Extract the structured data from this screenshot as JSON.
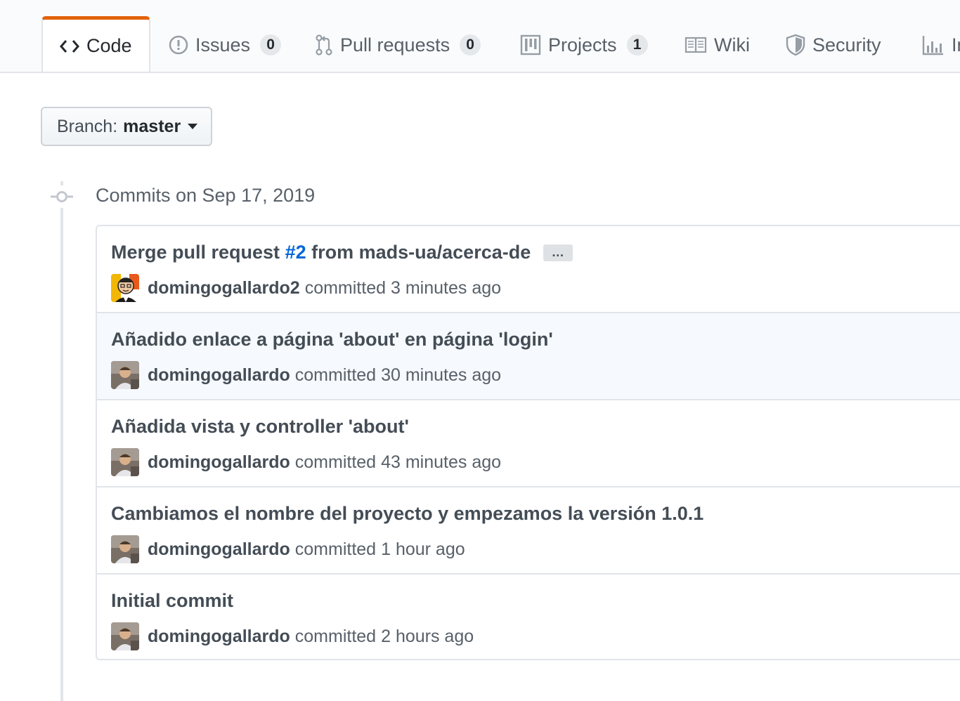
{
  "tabs": [
    {
      "label": "Code",
      "icon": "code-icon",
      "counter": null,
      "selected": true
    },
    {
      "label": "Issues",
      "icon": "issue-opened-icon",
      "counter": "0",
      "selected": false
    },
    {
      "label": "Pull requests",
      "icon": "git-pull-request-icon",
      "counter": "0",
      "selected": false
    },
    {
      "label": "Projects",
      "icon": "project-icon",
      "counter": "1",
      "selected": false
    },
    {
      "label": "Wiki",
      "icon": "book-icon",
      "counter": null,
      "selected": false
    },
    {
      "label": "Security",
      "icon": "shield-icon",
      "counter": null,
      "selected": false
    },
    {
      "label": "In",
      "icon": "graph-icon",
      "counter": null,
      "selected": false
    }
  ],
  "branch": {
    "prefix": "Branch:",
    "name": "master"
  },
  "day_heading": "Commits on Sep 17, 2019",
  "commits": [
    {
      "title_prefix": "Merge pull request ",
      "title_link": "#2",
      "title_suffix": " from mads-ua/acerca-de",
      "has_ellipsis": true,
      "ellipsis": "…",
      "author": "domingogallardo2",
      "verb": "committed",
      "time": "3 minutes ago",
      "avatar": "cartoon-avatar",
      "highlight": false
    },
    {
      "title_prefix": "Añadido enlace a página 'about' en página 'login'",
      "title_link": "",
      "title_suffix": "",
      "has_ellipsis": false,
      "author": "domingogallardo",
      "verb": "committed",
      "time": "30 minutes ago",
      "avatar": "photo-avatar",
      "highlight": true
    },
    {
      "title_prefix": "Añadida vista y controller 'about'",
      "title_link": "",
      "title_suffix": "",
      "has_ellipsis": false,
      "author": "domingogallardo",
      "verb": "committed",
      "time": "43 minutes ago",
      "avatar": "photo-avatar",
      "highlight": false
    },
    {
      "title_prefix": "Cambiamos el nombre del proyecto y empezamos la versión 1.0.1",
      "title_link": "",
      "title_suffix": "",
      "has_ellipsis": false,
      "author": "domingogallardo",
      "verb": "committed",
      "time": "1 hour ago",
      "avatar": "photo-avatar",
      "highlight": false
    },
    {
      "title_prefix": "Initial commit",
      "title_link": "",
      "title_suffix": "",
      "has_ellipsis": false,
      "author": "domingogallardo",
      "verb": "committed",
      "time": "2 hours ago",
      "avatar": "photo-avatar",
      "highlight": false
    }
  ],
  "colors": {
    "accent_tab": "#e36209",
    "link": "#0366d6",
    "highlight_row": "#f6f9fd"
  }
}
